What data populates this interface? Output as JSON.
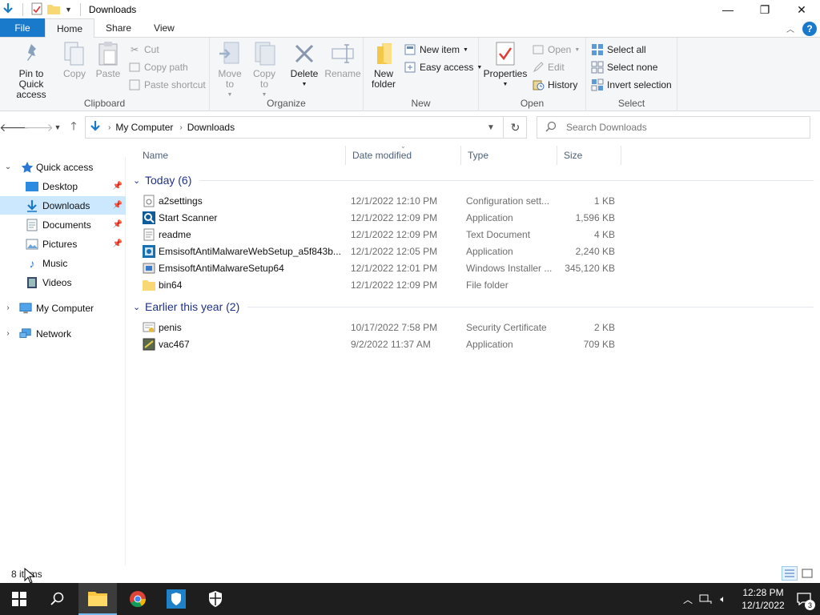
{
  "titlebar": {
    "title": "Downloads",
    "minimize_glyph": "—",
    "restore_glyph": "❐",
    "close_glyph": "✕"
  },
  "ribbon_tabs": {
    "file": "File",
    "home": "Home",
    "share": "Share",
    "view": "View"
  },
  "ribbon": {
    "clipboard": {
      "label": "Clipboard",
      "pin": "Pin to Quick access",
      "copy": "Copy",
      "paste": "Paste",
      "cut": "Cut",
      "copy_path": "Copy path",
      "paste_shortcut": "Paste shortcut"
    },
    "organize": {
      "label": "Organize",
      "move_to": "Move to",
      "copy_to": "Copy to",
      "delete": "Delete",
      "rename": "Rename"
    },
    "new": {
      "label": "New",
      "new_folder": "New folder",
      "new_item": "New item",
      "easy_access": "Easy access"
    },
    "open": {
      "label": "Open",
      "properties": "Properties",
      "open": "Open",
      "edit": "Edit",
      "history": "History"
    },
    "select": {
      "label": "Select",
      "select_all": "Select all",
      "select_none": "Select none",
      "invert": "Invert selection"
    }
  },
  "address": {
    "crumbs": [
      "My Computer",
      "Downloads"
    ],
    "search_placeholder": "Search Downloads"
  },
  "nav": {
    "quick_access": "Quick access",
    "items": [
      {
        "label": "Desktop",
        "pinned": true
      },
      {
        "label": "Downloads",
        "pinned": true,
        "selected": true
      },
      {
        "label": "Documents",
        "pinned": true
      },
      {
        "label": "Pictures",
        "pinned": true
      },
      {
        "label": "Music",
        "pinned": false
      },
      {
        "label": "Videos",
        "pinned": false
      }
    ],
    "my_computer": "My Computer",
    "network": "Network"
  },
  "columns": {
    "name": "Name",
    "date": "Date modified",
    "type": "Type",
    "size": "Size"
  },
  "groups": [
    {
      "header": "Today (6)",
      "files": [
        {
          "name": "a2settings",
          "date": "12/1/2022 12:10 PM",
          "type": "Configuration sett...",
          "size": "1 KB",
          "icon": "config-file-icon"
        },
        {
          "name": "Start Scanner",
          "date": "12/1/2022 12:09 PM",
          "type": "Application",
          "size": "1,596 KB",
          "icon": "scanner-app-icon"
        },
        {
          "name": "readme",
          "date": "12/1/2022 12:09 PM",
          "type": "Text Document",
          "size": "4 KB",
          "icon": "text-file-icon"
        },
        {
          "name": "EmsisoftAntiMalwareWebSetup_a5f843b...",
          "date": "12/1/2022 12:05 PM",
          "type": "Application",
          "size": "2,240 KB",
          "icon": "setup-app-icon"
        },
        {
          "name": "EmsisoftAntiMalwareSetup64",
          "date": "12/1/2022 12:01 PM",
          "type": "Windows Installer ...",
          "size": "345,120 KB",
          "icon": "installer-icon"
        },
        {
          "name": "bin64",
          "date": "12/1/2022 12:09 PM",
          "type": "File folder",
          "size": "",
          "icon": "folder-icon"
        }
      ]
    },
    {
      "header": "Earlier this year (2)",
      "files": [
        {
          "name": "penis",
          "date": "10/17/2022 7:58 PM",
          "type": "Security Certificate",
          "size": "2 KB",
          "icon": "certificate-icon"
        },
        {
          "name": "vac467",
          "date": "9/2/2022 11:37 AM",
          "type": "Application",
          "size": "709 KB",
          "icon": "app-icon"
        }
      ]
    }
  ],
  "status": {
    "count": "8 items"
  },
  "taskbar": {
    "time": "12:28 PM",
    "date": "12/1/2022",
    "notifications": "3"
  },
  "colors": {
    "accent": "#1979ca",
    "selection": "#cce8ff",
    "group_header": "#1e3287",
    "taskbar": "#1e1e1e"
  }
}
